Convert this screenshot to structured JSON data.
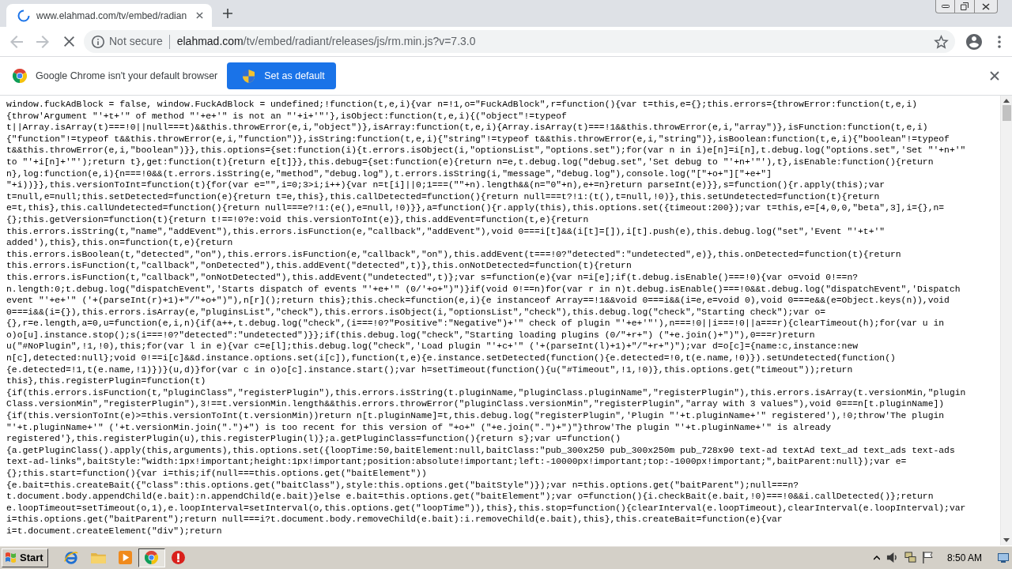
{
  "tab_strip": {
    "tabs": [
      {
        "title": "www.elahmad.com/tv/embed/radian",
        "loading": true,
        "selected": true
      }
    ]
  },
  "toolbar": {
    "back": {
      "disabled": true
    },
    "forward": {
      "disabled": true
    },
    "loading": true,
    "security": "Not secure",
    "url_host": "elahmad.com",
    "url_path": "/tv/embed/radiant/releases/js/rm.min.js?v=7.3.0"
  },
  "infobar": {
    "message": "Google Chrome isn't your default browser",
    "button": "Set as default"
  },
  "source": {
    "lines": [
      "window.fuckAdBlock = false, window.FuckAdBlock = undefined;!function(t,e,i){var n=!1,o=\"FuckAdBlock\",r=function(){var t=this,e={};this.errors={throwError:function(t,e,i)",
      "{throw'Argument \"'+t+'\" of method \"'+e+'\" is not an \"'+i+'\"'},isObject:function(t,e,i){(\"object\"!=typeof",
      "t||Array.isArray(t)===!0||null===t)&&this.throwError(e,i,\"object\")},isArray:function(t,e,i){Array.isArray(t)===!1&&this.throwError(e,i,\"array\")},isFunction:function(t,e,i)",
      "{\"function\"!=typeof t&&this.throwError(e,i,\"function\")},isString:function(t,e,i){\"string\"!=typeof t&&this.throwError(e,i,\"string\")},isBoolean:function(t,e,i){\"boolean\"!=typeof",
      "t&&this.throwError(e,i,\"boolean\")}},this.options={set:function(i){t.errors.isObject(i,\"optionsList\",\"options.set\");for(var n in i)e[n]=i[n],t.debug.log(\"options.set\",'Set \"'+n+'\"",
      "to \"'+i[n]+'\"');return t},get:function(t){return e[t]}},this.debug={set:function(e){return n=e,t.debug.log(\"debug.set\",'Set debug to \"'+n+'\"'),t},isEnable:function(){return",
      "n},log:function(e,i){n===!0&&(t.errors.isString(e,\"method\",\"debug.log\"),t.errors.isString(i,\"message\",\"debug.log\"),console.log(\"[\"+o+\"][\"+e+\"]",
      "\"+i))}},this.versionToInt=function(t){for(var e=\"\",i=0;3>i;i++){var n=t[i]||0;1===(\"\"+n).length&&(n=\"0\"+n),e+=n}return parseInt(e)}},s=function(){r.apply(this);var",
      "t=null,e=null;this.setDetected=function(e){return t=e,this},this.callDetected=function(){return null===t?!1:(t(),t=null,!0)},this.setUndetected=function(t){return",
      "e=t,this},this.callUndetected=function(){return null===e?!1:(e(),e=null,!0)}},a=function(){r.apply(this),this.options.set({timeout:200});var t=this,e=[4,0,0,\"beta\",3],i={},n=",
      "{};this.getVersion=function(t){return t!==!0?e:void this.versionToInt(e)},this.addEvent=function(t,e){return",
      "this.errors.isString(t,\"name\",\"addEvent\"),this.errors.isFunction(e,\"callback\",\"addEvent\"),void 0===i[t]&&(i[t]=[]),i[t].push(e),this.debug.log(\"set\",'Event \"'+t+'\"",
      "added'),this},this.on=function(t,e){return",
      "this.errors.isBoolean(t,\"detected\",\"on\"),this.errors.isFunction(e,\"callback\",\"on\"),this.addEvent(t===!0?\"detected\":\"undetected\",e)},this.onDetected=function(t){return",
      "this.errors.isFunction(t,\"callback\",\"onDetected\"),this.addEvent(\"detected\",t)},this.onNotDetected=function(t){return",
      "this.errors.isFunction(t,\"callback\",\"onNotDetected\"),this.addEvent(\"undetected\",t)};var s=function(e){var n=i[e];if(t.debug.isEnable()===!0){var o=void 0!==n?",
      "n.length:0;t.debug.log(\"dispatchEvent\",'Starts dispatch of events \"'+e+'\" (0/'+o+\")\")}if(void 0!==n)for(var r in n)t.debug.isEnable()===!0&&t.debug.log(\"dispatchEvent\",'Dispatch",
      "event \"'+e+'\" ('+(parseInt(r)+1)+\"/\"+o+\")\"),n[r]();return this};this.check=function(e,i){e instanceof Array==!1&&void 0===i&&(i=e,e=void 0),void 0===e&&(e=Object.keys(n)),void",
      "0===i&&(i={}),this.errors.isArray(e,\"pluginsList\",\"check\"),this.errors.isObject(i,\"optionsList\",\"check\"),this.debug.log(\"check\",\"Starting check\");var o=",
      "{},r=e.length,a=0,u=function(e,i,n){if(a++,t.debug.log(\"check\",(i===!0?\"Positive\":\"Negative\")+'\" check of plugin \"'+e+'\"'),n===!0||i===!0||a===r){clearTimeout(h);for(var u in",
      "o)o[u].instance.stop();s(i===!0?\"detected\":\"undetected\")}};if(this.debug.log(\"check\",\"Starting loading plugins (0/\"+r+\") (\"+e.join()+\")\"),0===r)return",
      "u(\"#NoPlugin\",!1,!0),this;for(var l in e){var c=e[l];this.debug.log(\"check\",'Load plugin \"'+c+'\" ('+(parseInt(l)+1)+\"/\"+r+\")\");var d=o[c]={name:c,instance:new",
      "n[c],detected:null};void 0!==i[c]&&d.instance.options.set(i[c]),function(t,e){e.instance.setDetected(function(){e.detected=!0,t(e.name,!0)}).setUndetected(function()",
      "{e.detected=!1,t(e.name,!1)})}(u,d)}for(var c in o)o[c].instance.start();var h=setTimeout(function(){u(\"#Timeout\",!1,!0)},this.options.get(\"timeout\"));return",
      "this},this.registerPlugin=function(t)",
      "{if(this.errors.isFunction(t,\"pluginClass\",\"registerPlugin\"),this.errors.isString(t.pluginName,\"pluginClass.pluginName\",\"registerPlugin\"),this.errors.isArray(t.versionMin,\"plugin",
      "Class.versionMin\",\"registerPlugin\"),3!==t.versionMin.length&&this.errors.throwError(\"pluginClass.versionMin\",\"registerPlugin\",\"array with 3 values\"),void 0===n[t.pluginName])",
      "{if(this.versionToInt(e)>=this.versionToInt(t.versionMin))return n[t.pluginName]=t,this.debug.log(\"registerPlugin\",'Plugin \"'+t.pluginName+'\" registered'),!0;throw'The plugin",
      "\"'+t.pluginName+'\" ('+t.versionMin.join(\".\")+\") is too recent for this version of \"+o+\" (\"+e.join(\".\")+\")\"}throw'The plugin \"'+t.pluginName+'\" is already",
      "registered'},this.registerPlugin(u),this.registerPlugin(l)};a.getPluginClass=function(){return s};var u=function()",
      "{a.getPluginClass().apply(this,arguments),this.options.set({loopTime:50,baitElement:null,baitClass:\"pub_300x250 pub_300x250m pub_728x90 text-ad textAd text_ad text_ads text-ads",
      "text-ad-links\",baitStyle:\"width:1px!important;height:1px!important;position:absolute!important;left:-10000px!important;top:-1000px!important;\",baitParent:null});var e=",
      "{};this.start=function(){var i=this;if(null===this.options.get(\"baitElement\"))",
      "{e.bait=this.createBait({\"class\":this.options.get(\"baitClass\"),style:this.options.get(\"baitStyle\")});var n=this.options.get(\"baitParent\");null===n?",
      "t.document.body.appendChild(e.bait):n.appendChild(e.bait)}else e.bait=this.options.get(\"baitElement\");var o=function(){i.checkBait(e.bait,!0)===!0&&i.callDetected()};return",
      "e.loopTimeout=setTimeout(o,1),e.loopInterval=setInterval(o,this.options.get(\"loopTime\")),this},this.stop=function(){clearInterval(e.loopTimeout),clearInterval(e.loopInterval);var",
      "i=this.options.get(\"baitParent\");return null===i?t.document.body.removeChild(e.bait):i.removeChild(e.bait),this},this.createBait=function(e){var",
      "i=t.document.createElement(\"div\");return"
    ]
  },
  "taskbar": {
    "start": "Start",
    "clock": "8:50 AM"
  }
}
